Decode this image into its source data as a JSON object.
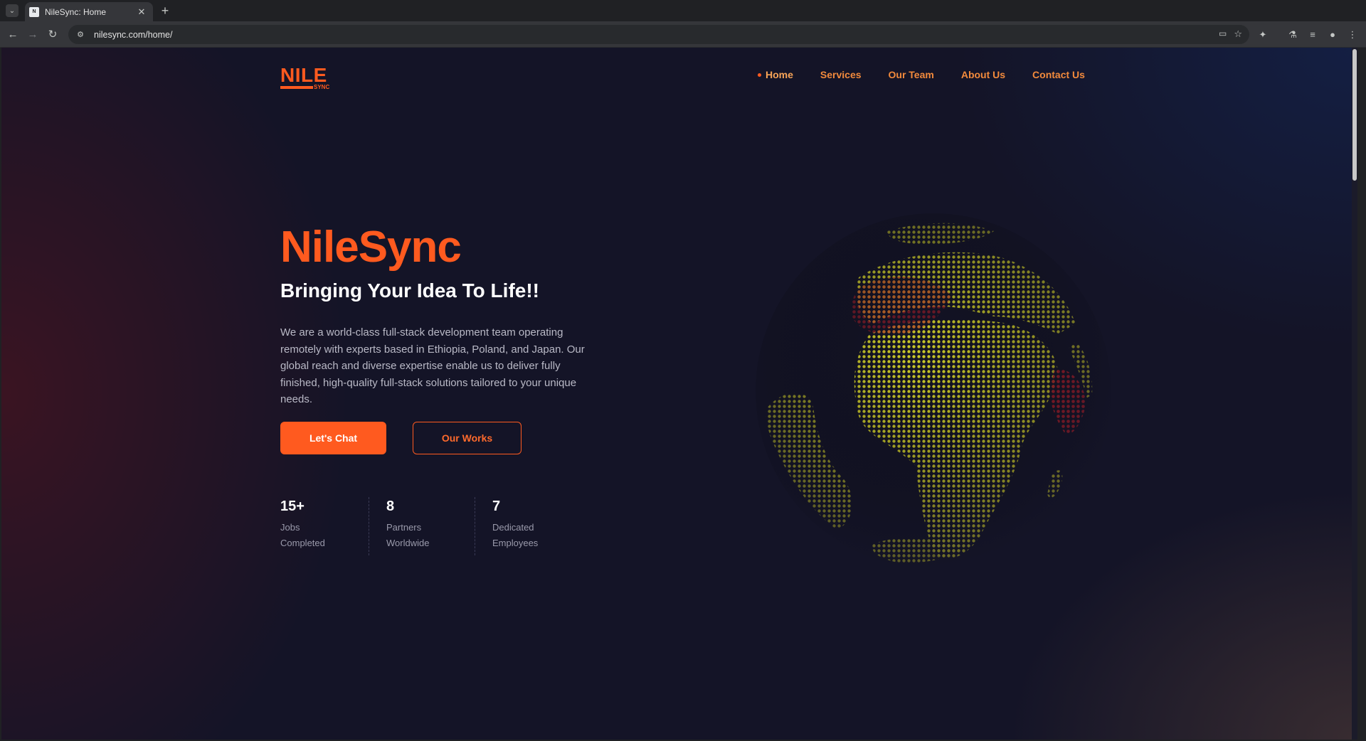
{
  "browser": {
    "tab_title": "NileSync: Home",
    "url": "nilesync.com/home/",
    "icons": [
      "tab-list-icon",
      "close-icon",
      "plus-icon",
      "back-icon",
      "forward-icon",
      "reload-icon",
      "site-info-icon",
      "cast-icon",
      "star-icon",
      "extensions-icon",
      "labs-icon",
      "media-icon",
      "profile-icon",
      "menu-icon"
    ]
  },
  "site": {
    "logo": {
      "main": "NILE",
      "sub": "SYNC"
    },
    "nav": [
      {
        "label": "Home",
        "active": true
      },
      {
        "label": "Services"
      },
      {
        "label": "Our Team"
      },
      {
        "label": "About Us"
      },
      {
        "label": "Contact Us"
      }
    ],
    "hero": {
      "title": "NileSync",
      "subtitle": "Bringing Your Idea To Life!!",
      "description": "We are a world-class full-stack development team operating remotely with experts based in Ethiopia, Poland, and Japan. Our global reach and diverse expertise enable us to deliver fully finished, high-quality full-stack solutions tailored to your unique needs.",
      "primary_button": "Let's Chat",
      "secondary_button": "Our Works"
    },
    "stats": [
      {
        "value": "15+",
        "line1": "Jobs",
        "line2": "Completed"
      },
      {
        "value": "8",
        "line1": "Partners",
        "line2": "Worldwide"
      },
      {
        "value": "7",
        "line1": "Dedicated",
        "line2": "Employees"
      }
    ],
    "colors": {
      "accent": "#ff5a1f",
      "background": "#141427",
      "globe_dots": "#d8d62a",
      "globe_highlight": "#c0202a"
    }
  }
}
